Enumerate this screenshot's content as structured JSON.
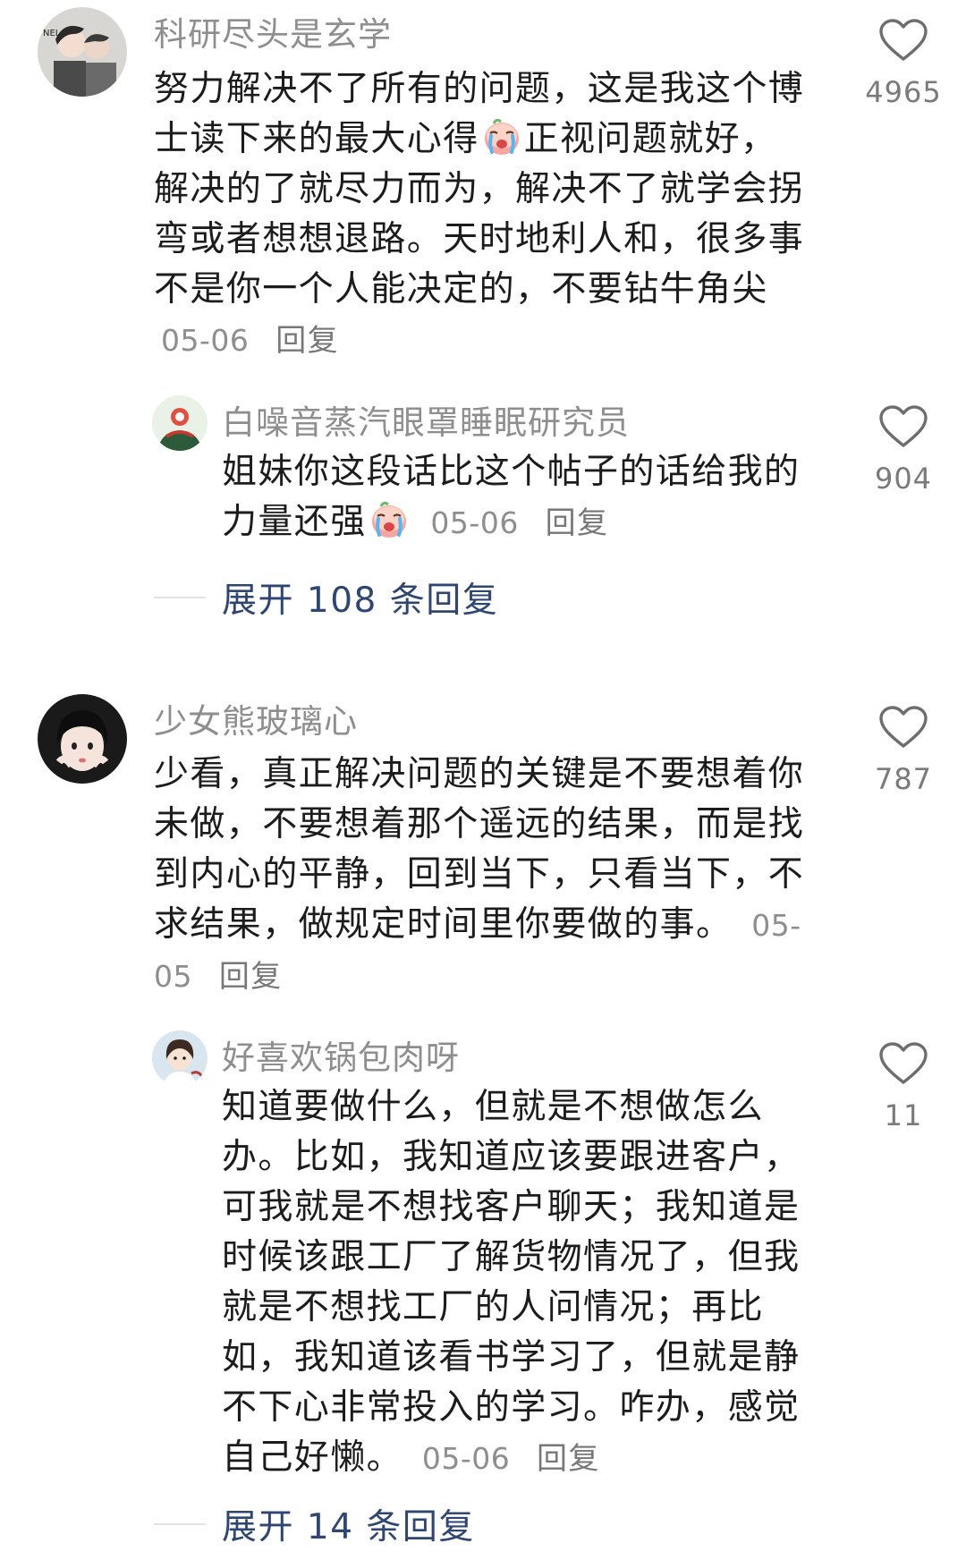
{
  "threads": [
    {
      "comment": {
        "username": "科研尽头是玄学",
        "text_before_emoji": "努力解决不了所有的问题，这是我这个博士读下来的最大心得",
        "text_after_emoji": "正视问题就好，解决的了就尽力而为，解决不了就学会拐弯或者想想退路。天时地利人和，很多事不是你一个人能决定的，不要钻牛角尖",
        "date": "05-06",
        "reply_label": "回复",
        "likes": "4965",
        "emoji": "crying-face-emoji"
      },
      "reply": {
        "username": "白噪音蒸汽眼罩睡眠研究员",
        "text_before_emoji": "姐妹你这段话比这个帖子的话给我的力量还强",
        "date": "05-06",
        "reply_label": "回复",
        "likes": "904",
        "emoji": "crying-face-emoji"
      },
      "expand_label": "展开 108 条回复"
    },
    {
      "comment": {
        "username": "少女熊玻璃心",
        "text": "少看，真正解决问题的关键是不要想着你未做，不要想着那个遥远的结果，而是找到内心的平静，回到当下，只看当下，不求结果，做规定时间里你要做的事。",
        "date": "05-05",
        "reply_label": "回复",
        "likes": "787"
      },
      "reply": {
        "username": "好喜欢锅包肉呀",
        "text": "知道要做什么，但就是不想做怎么办。比如，我知道应该要跟进客户，可我就是不想找客户聊天；我知道是时候该跟工厂了解货物情况了，但我就是不想找工厂的人问情况；再比如，我知道该看书学习了，但就是静不下心非常投入的学习。咋办，感觉自己好懒。",
        "date": "05-06",
        "reply_label": "回复",
        "likes": "11"
      },
      "expand_label": "展开 14 条回复"
    }
  ],
  "colors": {
    "username": "#8e8e8e",
    "body": "#1c1c1c",
    "meta": "#8e8e8e",
    "expand": "#2f4770",
    "heart_outline": "#6e6e6e"
  },
  "icons": {
    "like": "heart-outline-icon",
    "emoji": "crying-face-emoji"
  }
}
